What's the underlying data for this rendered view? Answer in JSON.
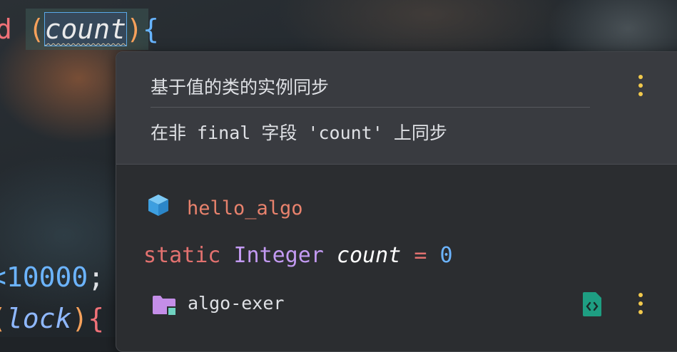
{
  "editor": {
    "line1": {
      "keyword_fragment": "d",
      "open_paren": "(",
      "variable": "count",
      "close_paren_brace": ")",
      "brace": "{"
    },
    "line3": {
      "lt": "<",
      "number": "10000",
      "semi": ";"
    },
    "line4": {
      "open_paren": "(",
      "variable": "lock",
      "close_paren": ")",
      "brace": "{"
    }
  },
  "popup": {
    "inspection_title": "基于值的类的实例同步",
    "inspection_description": "在非 final 字段 'count' 上同步",
    "module": {
      "icon": "module-cube-icon",
      "name": "hello_algo"
    },
    "declaration": {
      "modifier": "static",
      "type": "Integer",
      "name": "count",
      "operator": "=",
      "value": "0"
    },
    "project": {
      "icon": "folder-icon",
      "name": "algo-exer",
      "action_icon": "source-file-icon"
    },
    "menu_icon": "more-vertical-icon"
  },
  "colors": {
    "accent_yellow": "#f2c94c",
    "keyword_red": "#e2716f",
    "type_purple": "#c39af2",
    "number_blue": "#6cb4ff",
    "module_orange": "#e8826d"
  }
}
